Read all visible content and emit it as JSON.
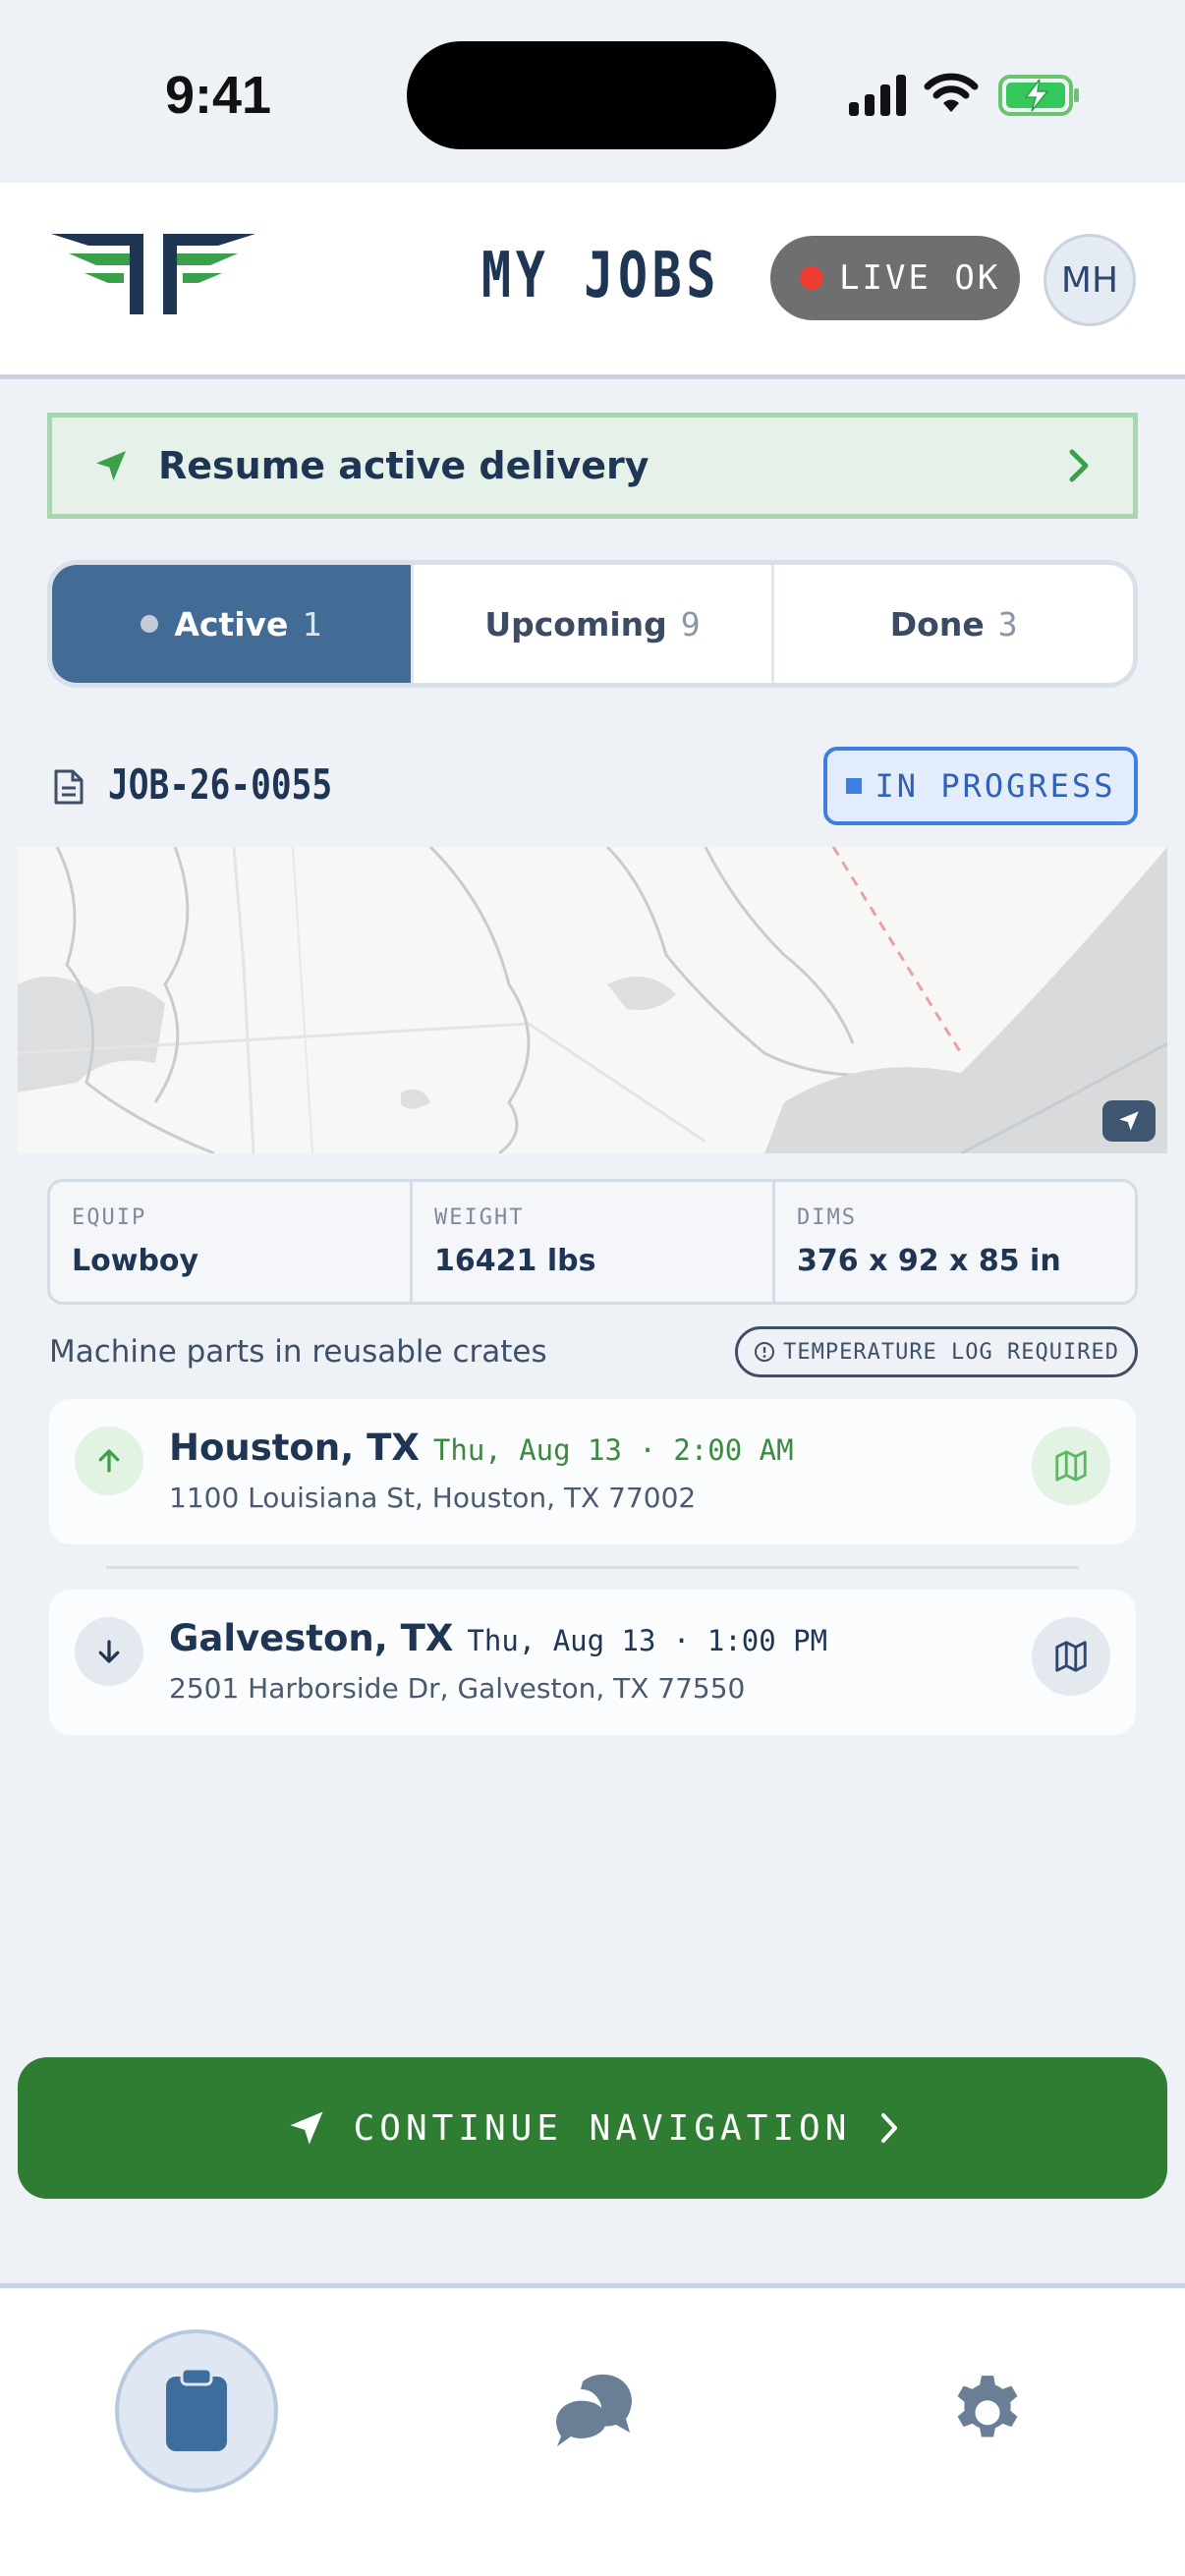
{
  "status_bar": {
    "time": "9:41"
  },
  "header": {
    "title": "MY JOBS",
    "live_label": "LIVE OK",
    "avatar_initials": "MH"
  },
  "resume_banner": {
    "label": "Resume active delivery"
  },
  "tabs": [
    {
      "label": "Active",
      "count": "1",
      "selected": true
    },
    {
      "label": "Upcoming",
      "count": "9",
      "selected": false
    },
    {
      "label": "Done",
      "count": "3",
      "selected": false
    }
  ],
  "job": {
    "id": "JOB-26-0055",
    "status": "IN PROGRESS",
    "specs": [
      {
        "label": "EQUIP",
        "value": "Lowboy"
      },
      {
        "label": "WEIGHT",
        "value": "16421 lbs"
      },
      {
        "label": "DIMS",
        "value": "376 x 92 x 85 in"
      }
    ],
    "cargo": "Machine parts in reusable crates",
    "requirement": "TEMPERATURE LOG REQUIRED",
    "stops": [
      {
        "type": "pickup",
        "city": "Houston, TX",
        "time": "Thu, Aug 13 · 2:00 AM",
        "address": "1100 Louisiana St, Houston, TX 77002"
      },
      {
        "type": "dropoff",
        "city": "Galveston, TX",
        "time": "Thu, Aug 13 · 1:00 PM",
        "address": "2501 Harborside Dr, Galveston, TX 77550"
      }
    ]
  },
  "cta": {
    "label": "CONTINUE NAVIGATION"
  },
  "colors": {
    "primary_blue": "#426c95",
    "accent_green": "#2e7d32",
    "pickup_green": "#4caf50",
    "status_blue": "#3d7ee0",
    "live_red": "#ef3d33"
  }
}
